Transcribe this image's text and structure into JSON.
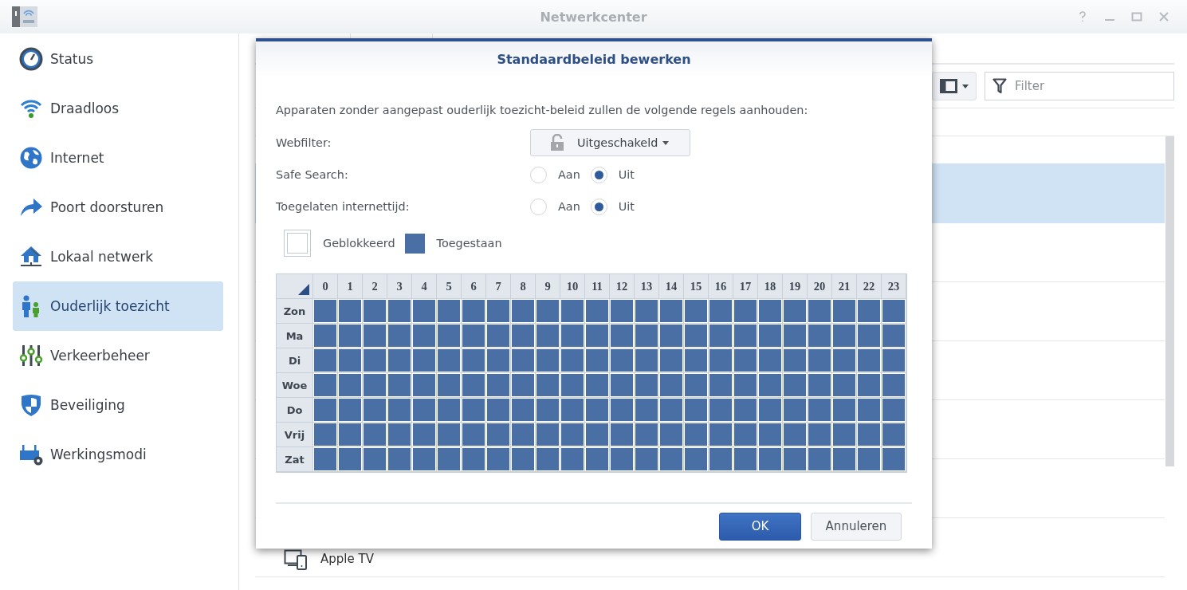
{
  "window": {
    "title": "Netwerkcenter"
  },
  "sidebar": {
    "items": [
      {
        "label": "Status",
        "selected": false
      },
      {
        "label": "Draadloos",
        "selected": false
      },
      {
        "label": "Internet",
        "selected": false
      },
      {
        "label": "Poort doorsturen",
        "selected": false
      },
      {
        "label": "Lokaal netwerk",
        "selected": false
      },
      {
        "label": "Ouderlijk toezicht",
        "selected": true
      },
      {
        "label": "Verkeerbeheer",
        "selected": false
      },
      {
        "label": "Beveiliging",
        "selected": false
      },
      {
        "label": "Werkingsmodi",
        "selected": false
      }
    ]
  },
  "toolbar": {
    "filter": {
      "placeholder": "Filter"
    }
  },
  "device_list": {
    "rows": [
      {
        "selected": false
      },
      {
        "selected": true
      },
      {
        "selected": false
      },
      {
        "selected": false
      },
      {
        "selected": false
      },
      {
        "selected": false
      },
      {
        "selected": false
      },
      {
        "name": "Apple TV",
        "selected": false
      }
    ]
  },
  "dialog": {
    "title": "Standaardbeleid bewerken",
    "intro": "Apparaten zonder aangepast ouderlijk toezicht-beleid zullen de volgende regels aanhouden:",
    "webfilter": {
      "label": "Webfilter:",
      "value": "Uitgeschakeld"
    },
    "radio_rows": [
      {
        "label": "Safe Search:",
        "options": [
          {
            "label": "Aan",
            "selected": false
          },
          {
            "label": "Uit",
            "selected": true
          }
        ]
      },
      {
        "label": "Toegelaten internettijd:",
        "options": [
          {
            "label": "Aan",
            "selected": false
          },
          {
            "label": "Uit",
            "selected": true
          }
        ]
      }
    ],
    "legend": [
      {
        "label": "Geblokkeerd",
        "allowed": false
      },
      {
        "label": "Toegestaan",
        "allowed": true
      }
    ],
    "schedule": {
      "hours": [
        "0",
        "1",
        "2",
        "3",
        "4",
        "5",
        "6",
        "7",
        "8",
        "9",
        "10",
        "11",
        "12",
        "13",
        "14",
        "15",
        "16",
        "17",
        "18",
        "19",
        "20",
        "21",
        "22",
        "23"
      ],
      "days": [
        {
          "label": "Zon",
          "allowed": [
            true,
            true,
            true,
            true,
            true,
            true,
            true,
            true,
            true,
            true,
            true,
            true,
            true,
            true,
            true,
            true,
            true,
            true,
            true,
            true,
            true,
            true,
            true,
            true
          ]
        },
        {
          "label": "Ma",
          "allowed": [
            true,
            true,
            true,
            true,
            true,
            true,
            true,
            true,
            true,
            true,
            true,
            true,
            true,
            true,
            true,
            true,
            true,
            true,
            true,
            true,
            true,
            true,
            true,
            true
          ]
        },
        {
          "label": "Di",
          "allowed": [
            true,
            true,
            true,
            true,
            true,
            true,
            true,
            true,
            true,
            true,
            true,
            true,
            true,
            true,
            true,
            true,
            true,
            true,
            true,
            true,
            true,
            true,
            true,
            true
          ]
        },
        {
          "label": "Woe",
          "allowed": [
            true,
            true,
            true,
            true,
            true,
            true,
            true,
            true,
            true,
            true,
            true,
            true,
            true,
            true,
            true,
            true,
            true,
            true,
            true,
            true,
            true,
            true,
            true,
            true
          ]
        },
        {
          "label": "Do",
          "allowed": [
            true,
            true,
            true,
            true,
            true,
            true,
            true,
            true,
            true,
            true,
            true,
            true,
            true,
            true,
            true,
            true,
            true,
            true,
            true,
            true,
            true,
            true,
            true,
            true
          ]
        },
        {
          "label": "Vrij",
          "allowed": [
            true,
            true,
            true,
            true,
            true,
            true,
            true,
            true,
            true,
            true,
            true,
            true,
            true,
            true,
            true,
            true,
            true,
            true,
            true,
            true,
            true,
            true,
            true,
            true
          ]
        },
        {
          "label": "Zat",
          "allowed": [
            true,
            true,
            true,
            true,
            true,
            true,
            true,
            true,
            true,
            true,
            true,
            true,
            true,
            true,
            true,
            true,
            true,
            true,
            true,
            true,
            true,
            true,
            true,
            true
          ]
        }
      ]
    },
    "buttons": [
      {
        "label": "OK",
        "kind": "primary"
      },
      {
        "label": "Annuleren",
        "kind": "secondary"
      }
    ]
  }
}
